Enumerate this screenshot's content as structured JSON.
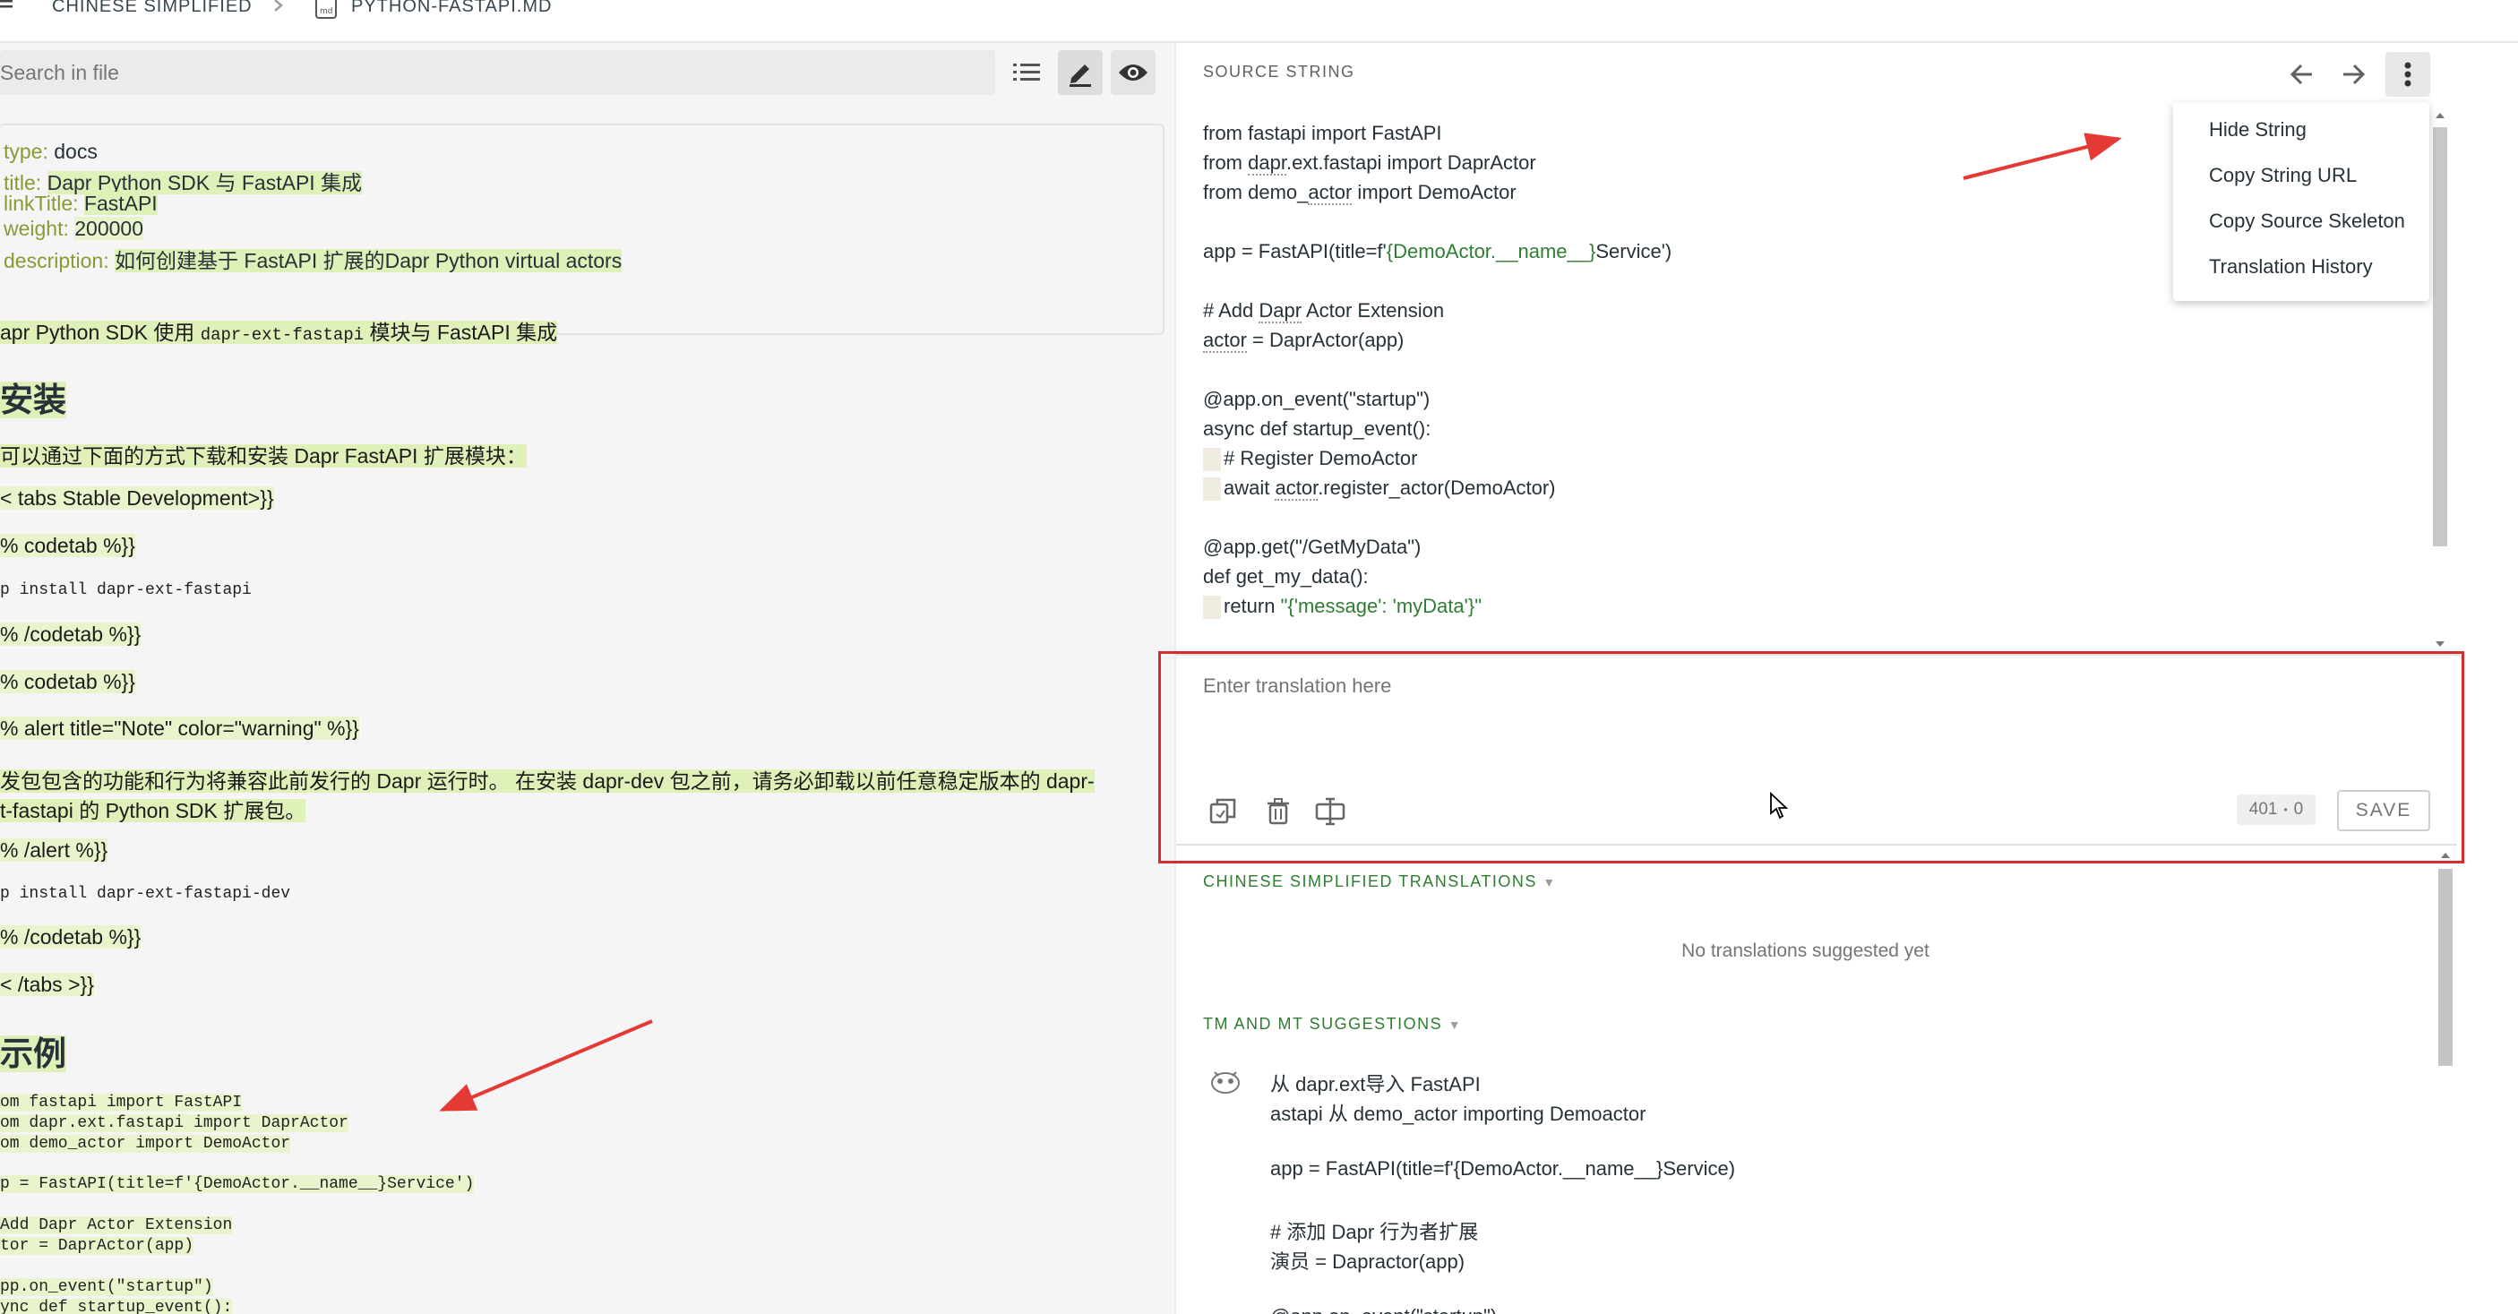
{
  "breadcrumb": {
    "language": "CHINESE SIMPLIFIED",
    "file": "PYTHON-FASTAPI.MD"
  },
  "editor": {
    "search_placeholder": "Search in file",
    "front_matter": [
      {
        "key": "type:",
        "value": "docs"
      },
      {
        "key": "title:",
        "value": "Dapr Python SDK 与 FastAPI 集成"
      },
      {
        "key": "linkTitle:",
        "value": "FastAPI"
      },
      {
        "key": "weight:",
        "value": "200000"
      },
      {
        "key": "description:",
        "value": "如何创建基于 FastAPI 扩展的Dapr Python virtual actors"
      }
    ],
    "intro_a": "apr Python SDK 使用 ",
    "intro_code": "dapr-ext-fastapi",
    "intro_b": " 模块与 FastAPI 集成",
    "heading_install": "安装",
    "install_text": "可以通过下面的方式下载和安装 Dapr FastAPI 扩展模块：",
    "tabs_open": "< tabs Stable Development>}}",
    "codetab_open_1": "% codetab %}}",
    "pip_stable": "p install dapr-ext-fastapi",
    "codetab_close_1": "% /codetab %}}",
    "codetab_open_2": "% codetab %}}",
    "alert_open": "% alert title=\"Note\" color=\"warning\" %}}",
    "alert_line1": "发包包含的功能和行为将兼容此前发行的 Dapr 运行时。 在安装 dapr-dev 包之前，请务必卸载以前任意稳定版本的 dapr-",
    "alert_line2": "t-fastapi 的 Python SDK 扩展包。",
    "alert_close": "% /alert %}}",
    "pip_dev": "p install dapr-ext-fastapi-dev",
    "codetab_close_2": "% /codetab %}}",
    "tabs_close": "< /tabs >}}",
    "heading_example": "示例",
    "code_lines": [
      "om fastapi import FastAPI",
      "om dapr.ext.fastapi import DaprActor",
      "om demo_actor import DemoActor",
      "",
      "p = FastAPI(title=f'{DemoActor.__name__}Service')",
      "",
      "Add Dapr Actor Extension",
      "tor = DaprActor(app)",
      "",
      "pp.on_event(\"startup\")",
      "ync def startup_event():"
    ]
  },
  "source_panel": {
    "label": "SOURCE STRING",
    "menu": [
      "Hide String",
      "Copy String URL",
      "Copy Source Skeleton",
      "Translation History"
    ],
    "lines": {
      "l1": "from fastapi import FastAPI",
      "l2a": "from ",
      "l2b": "dapr",
      "l2c": ".ext.fastapi import DaprActor",
      "l3a": "from demo_",
      "l3b": "actor",
      "l3c": " import DemoActor",
      "l4a": "app = FastAPI(title=f'",
      "l4b": "{DemoActor.__name__}",
      "l4c": "Service')",
      "l5a": "# Add ",
      "l5b": "Dapr",
      "l5c": " Actor Extension",
      "l6a": "actor",
      "l6b": " = DaprActor(app)",
      "l7": "@app.on_event(\"startup\")",
      "l8": "async def startup_event():",
      "l9": "# Register DemoActor",
      "l10a": "await ",
      "l10b": "actor",
      "l10c": ".register_actor(DemoActor)",
      "l11": "@app.get(\"/GetMyData\")",
      "l12": "def get_my_data():",
      "l13a": "return ",
      "l13b": "\"{'message': 'myData'}\""
    }
  },
  "translation": {
    "placeholder": "Enter translation here",
    "counter_a": "401",
    "counter_sep": "•",
    "counter_b": "0",
    "save_label": "SAVE"
  },
  "translations_section": {
    "label": "CHINESE SIMPLIFIED TRANSLATIONS",
    "empty": "No translations suggested yet"
  },
  "suggestions_section": {
    "label": "TM AND MT SUGGESTIONS",
    "lines": [
      "从 dapr.ext导入 FastAPI",
      "astapi 从 demo_actor importing Demoactor",
      "",
      "app = FastAPI(title=f'{DemoActor.__name__}Service)",
      "",
      "# 添加 Dapr 行为者扩展",
      "演员 = Dapractor(app)",
      "",
      "@app.on_event(\"startup\")"
    ]
  },
  "colors": {
    "accent_green": "#2e7d32",
    "highlight": "#dff0b8",
    "annotation_red": "#d32f2f"
  }
}
